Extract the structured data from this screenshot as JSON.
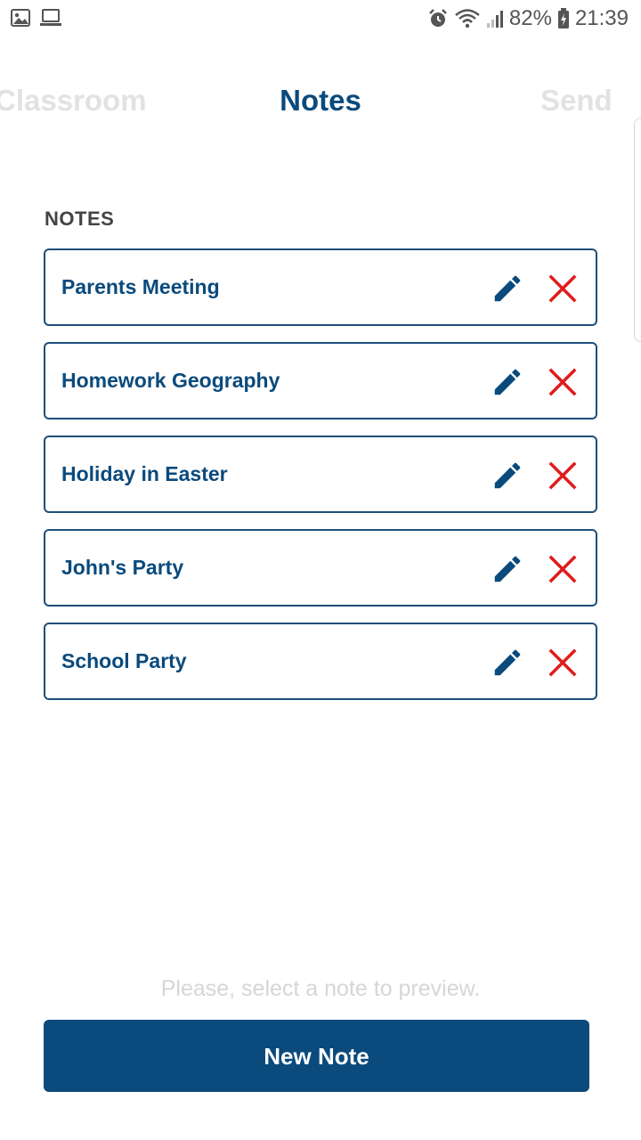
{
  "status_bar": {
    "icons_left": [
      "image-icon",
      "laptop-icon"
    ],
    "icons_right": [
      "alarm-icon",
      "wifi-icon",
      "signal-icon",
      "battery-icon"
    ],
    "battery": "82%",
    "time": "21:39"
  },
  "tabs": [
    {
      "label": "Classroom",
      "active": false
    },
    {
      "label": "Notes",
      "active": true
    },
    {
      "label": "Send",
      "active": false
    }
  ],
  "section": {
    "title": "NOTES"
  },
  "notes": [
    {
      "title": "Parents Meeting"
    },
    {
      "title": "Homework Geography"
    },
    {
      "title": "Holiday in Easter"
    },
    {
      "title": "John's Party"
    },
    {
      "title": "School Party"
    }
  ],
  "note_actions": {
    "edit_icon": "pencil-icon",
    "delete_icon": "close-icon"
  },
  "hint": "Please, select a note to preview.",
  "new_note_label": "New Note",
  "colors": {
    "primary": "#0a4a7c",
    "border": "#1d4e79",
    "delete": "#e01b1b",
    "inactive_tab": "#e2e2e2",
    "hint": "#d6d6d6"
  }
}
